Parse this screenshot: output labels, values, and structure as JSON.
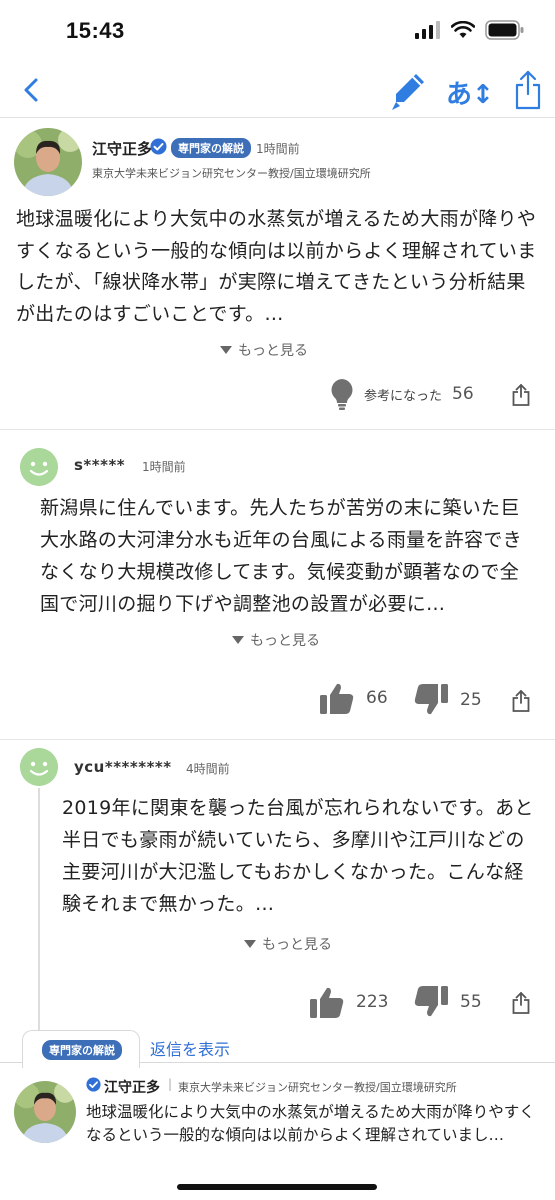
{
  "status": {
    "time": "15:43"
  },
  "nav": {
    "font_button_label": "あ↕"
  },
  "expert": {
    "name": "江守正多",
    "badge": "専門家の解説",
    "time": "1時間前",
    "affiliation": "東京大学未来ビジョン研究センター教授/国立環境研究所",
    "body": "地球温暖化により大気中の水蒸気が増えるため大雨が降りやすくなるという一般的な傾向は以前からよく理解されていましたが、「線状降水帯」が実際に増えてきたという分析結果が出たのはすごいことです。…",
    "more_label": "もっと見る",
    "helpful_label": "参考になった",
    "helpful_count": "56"
  },
  "comments": [
    {
      "user": "s*****",
      "time": "1時間前",
      "body": "新潟県に住んでいます。先人たちが苦労の末に築いた巨大水路の大河津分水も近年の台風による雨量を許容できなくなり大規模改修してます。気候変動が顕著なので全国で河川の掘り下げや調整池の設置が必要に…",
      "more_label": "もっと見る",
      "likes": "66",
      "dislikes": "25"
    },
    {
      "user": "ycu********",
      "time": "4時間前",
      "body": "2019年に関東を襲った台風が忘れられないです。あと半日でも豪雨が続いていたら、多摩川や江戸川などの主要河川が大氾濫してもおかしくなかった。こんな経験それまで無かった。…",
      "more_label": "もっと見る",
      "likes": "223",
      "dislikes": "55",
      "replies_label": "返信を表示"
    }
  ],
  "bottom_panel": {
    "tab_badge": "専門家の解説",
    "name": "江守正多",
    "separator": "|",
    "affiliation": "東京大学未来ビジョン研究センター教授/国立環境研究所",
    "body": "地球温暖化により大気中の水蒸気が増えるため大雨が降りやすくなるという一般的な傾向は以前からよく理解されていまし…"
  },
  "colors": {
    "accent": "#2f7de1",
    "badge": "#3d6fb8",
    "smiley": "#a9d89a"
  },
  "icons": [
    "signal-icon",
    "wifi-icon",
    "battery-icon",
    "back-icon",
    "pen-icon",
    "share-icon",
    "lightbulb-icon",
    "thumbs-up-icon",
    "thumbs-down-icon",
    "verified-icon",
    "smiley-avatar-icon"
  ]
}
